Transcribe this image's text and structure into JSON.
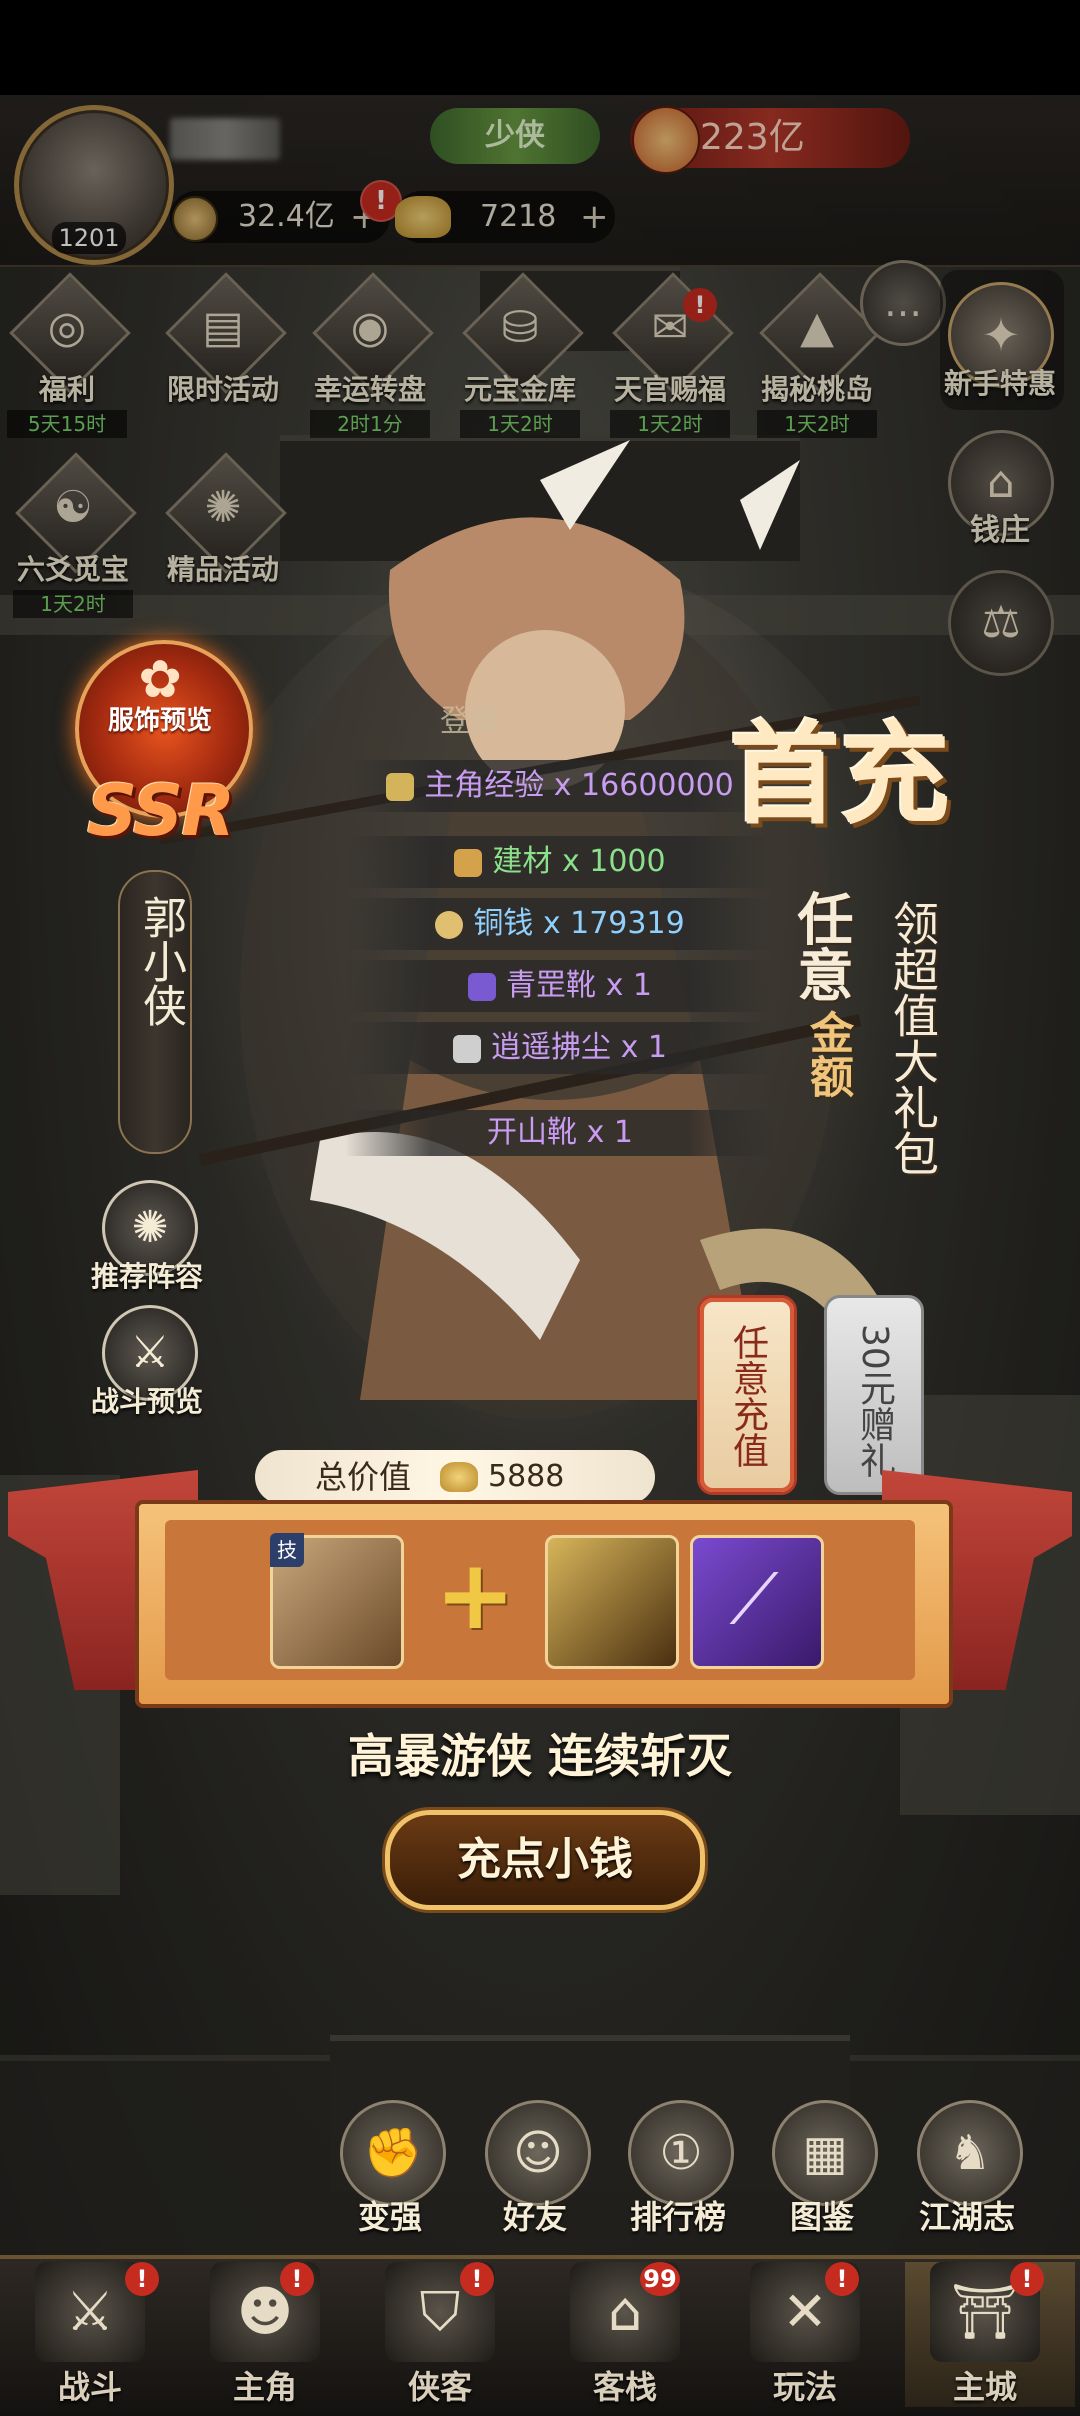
{
  "player": {
    "level": "1201",
    "rank": "少侠",
    "power": "223亿",
    "coins": "32.4亿",
    "ingots": "7218",
    "plus": "+",
    "alert": "!"
  },
  "activities": [
    {
      "label": "福利",
      "timer": "5天15时",
      "icon": "gift-coin-icon",
      "glyph": "◎"
    },
    {
      "label": "限时活动",
      "timer": "",
      "icon": "cards-icon",
      "glyph": "▤"
    },
    {
      "label": "幸运转盘",
      "timer": "2时1分",
      "icon": "wheel-icon",
      "glyph": "◉"
    },
    {
      "label": "元宝金库",
      "timer": "1天2时",
      "icon": "treasure-icon",
      "glyph": "⛁"
    },
    {
      "label": "天官赐福",
      "timer": "1天2时",
      "icon": "blessing-icon",
      "glyph": "✉"
    },
    {
      "label": "揭秘桃岛",
      "timer": "1天2时",
      "icon": "island-icon",
      "glyph": "▲"
    },
    {
      "label": "六爻觅宝",
      "timer": "1天2时",
      "icon": "divination-icon",
      "glyph": "☯"
    },
    {
      "label": "精品活动",
      "timer": "",
      "icon": "fan-icon",
      "glyph": "✺"
    }
  ],
  "right_side": {
    "chat_glyph": "…",
    "newbie_label": "新手特惠",
    "bank_label": "钱庄"
  },
  "hero": {
    "costume_label": "服饰预览",
    "rarity": "SSR",
    "name": "郭小侠"
  },
  "side_buttons": {
    "recommend_label": "推荐阵容",
    "battle_preview_label": "战斗预览"
  },
  "rewards": {
    "title": "登录",
    "items": [
      {
        "text": "主角经验 x 16600000",
        "color": "#c89cf0"
      },
      {
        "text": "建材 x 1000",
        "color": "#8be08b"
      },
      {
        "text": "铜钱 x 179319",
        "color": "#8fd0ff"
      },
      {
        "text": "青罡靴 x 1",
        "color": "#c89cf0"
      },
      {
        "text": "逍遥拂尘 x 1",
        "color": "#c89cf0"
      },
      {
        "text": "开山靴 x 1",
        "color": "#c89cf0"
      }
    ]
  },
  "promo": {
    "first_charge": "首充",
    "any_amount_1": "任意",
    "any_amount_2": "金额",
    "super_gift": "领超值大礼包"
  },
  "tabs": {
    "any_recharge": "任意充值",
    "gift_30": "30元赠礼"
  },
  "gift": {
    "total_label": "总价值",
    "total_value": "5888",
    "slot1_tag": "技",
    "plus": "+",
    "tagline": "高暴游侠 连续斩灭",
    "buy_label": "充点小钱"
  },
  "functions": [
    {
      "label": "变强",
      "glyph": "✊"
    },
    {
      "label": "好友",
      "glyph": "☺"
    },
    {
      "label": "排行榜",
      "glyph": "①"
    },
    {
      "label": "图鉴",
      "glyph": "▦"
    },
    {
      "label": "江湖志",
      "glyph": "♞"
    }
  ],
  "nav": [
    {
      "label": "战斗",
      "glyph": "⚔",
      "badge": "!"
    },
    {
      "label": "主角",
      "glyph": "☻",
      "badge": "!"
    },
    {
      "label": "侠客",
      "glyph": "⛉",
      "badge": "!"
    },
    {
      "label": "客栈",
      "glyph": "⌂",
      "badge": "99"
    },
    {
      "label": "玩法",
      "glyph": "✕",
      "badge": "!"
    },
    {
      "label": "主城",
      "glyph": "⛩",
      "badge": "!"
    }
  ]
}
